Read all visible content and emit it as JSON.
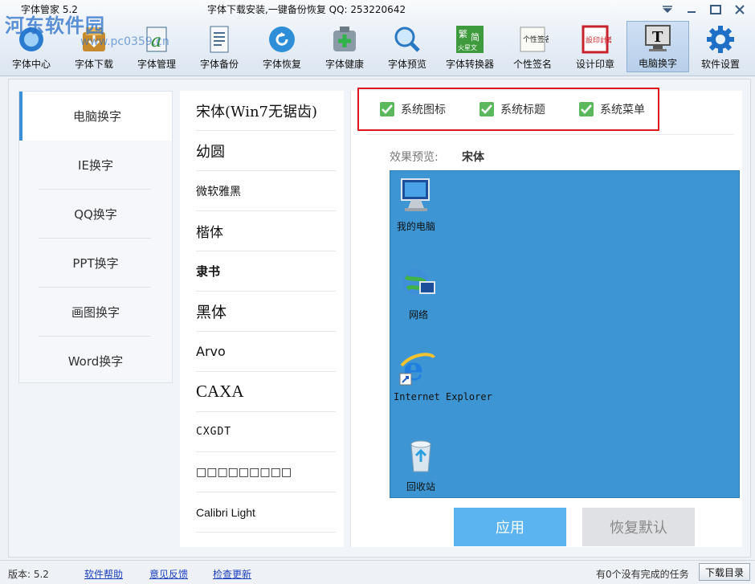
{
  "app": {
    "title": "字体管家 5.2",
    "marquee": "字体下载安装,一键备份恢复 QQ: 253220642",
    "watermark": "河东软件园",
    "watermark_url": "www.pc0359.cn"
  },
  "toolbar": {
    "items": [
      {
        "label": "字体中心",
        "icon": "font-center-icon"
      },
      {
        "label": "字体下载",
        "icon": "font-download-icon"
      },
      {
        "label": "字体管理",
        "icon": "font-manage-icon"
      },
      {
        "label": "字体备份",
        "icon": "font-backup-icon"
      },
      {
        "label": "字体恢复",
        "icon": "font-restore-icon"
      },
      {
        "label": "字体健康",
        "icon": "font-health-icon"
      },
      {
        "label": "字体预览",
        "icon": "magnifier-icon"
      },
      {
        "label": "字体转换器",
        "icon": "converter-icon"
      },
      {
        "label": "个性签名",
        "icon": "signature-icon"
      },
      {
        "label": "设计印章",
        "icon": "seal-icon"
      },
      {
        "label": "电脑换字",
        "icon": "computer-font-icon"
      },
      {
        "label": "软件设置",
        "icon": "gear-icon"
      }
    ],
    "converter_glyph_top": "繁",
    "converter_glyph_mid": "简",
    "converter_glyph_bottom": "火星文",
    "signature_glyphs": "个性签名",
    "seal_glyphs": "設印計章",
    "computer_font_glyph": "T"
  },
  "leftnav": {
    "items": [
      {
        "label": "电脑换字"
      },
      {
        "label": "IE换字"
      },
      {
        "label": "QQ换字"
      },
      {
        "label": "PPT换字"
      },
      {
        "label": "画图换字"
      },
      {
        "label": "Word换字"
      }
    ]
  },
  "fonts": {
    "items": [
      "宋体(Win7无锯齿)",
      "幼圆",
      "微软雅黑",
      "楷体",
      "隶书",
      "黑体",
      "Arvo",
      "CAXA",
      "CXGDT",
      "□□□□□□□□□",
      "Calibri Light"
    ]
  },
  "options": {
    "items": [
      {
        "label": "系统图标",
        "checked": true
      },
      {
        "label": "系统标题",
        "checked": true
      },
      {
        "label": "系统菜单",
        "checked": true
      }
    ]
  },
  "preview": {
    "label": "效果预览:",
    "font": "宋体",
    "icons": [
      {
        "label": "我的电脑"
      },
      {
        "label": "网络"
      },
      {
        "label": "Internet Explorer"
      },
      {
        "label": "回收站"
      }
    ]
  },
  "actions": {
    "apply": "应用",
    "reset": "恢复默认"
  },
  "status": {
    "version": "版本: 5.2",
    "links": [
      "软件帮助",
      "意见反馈",
      "检查更新"
    ],
    "tasks": "有0个没有完成的任务",
    "download_btn": "下载目录"
  },
  "colors": {
    "accent": "#3b8fd6",
    "desktop_bg": "#3d96d3",
    "apply_btn": "#5bb4ef",
    "checkbox": "#5cb85c",
    "highlight_box": "#e0141d"
  }
}
